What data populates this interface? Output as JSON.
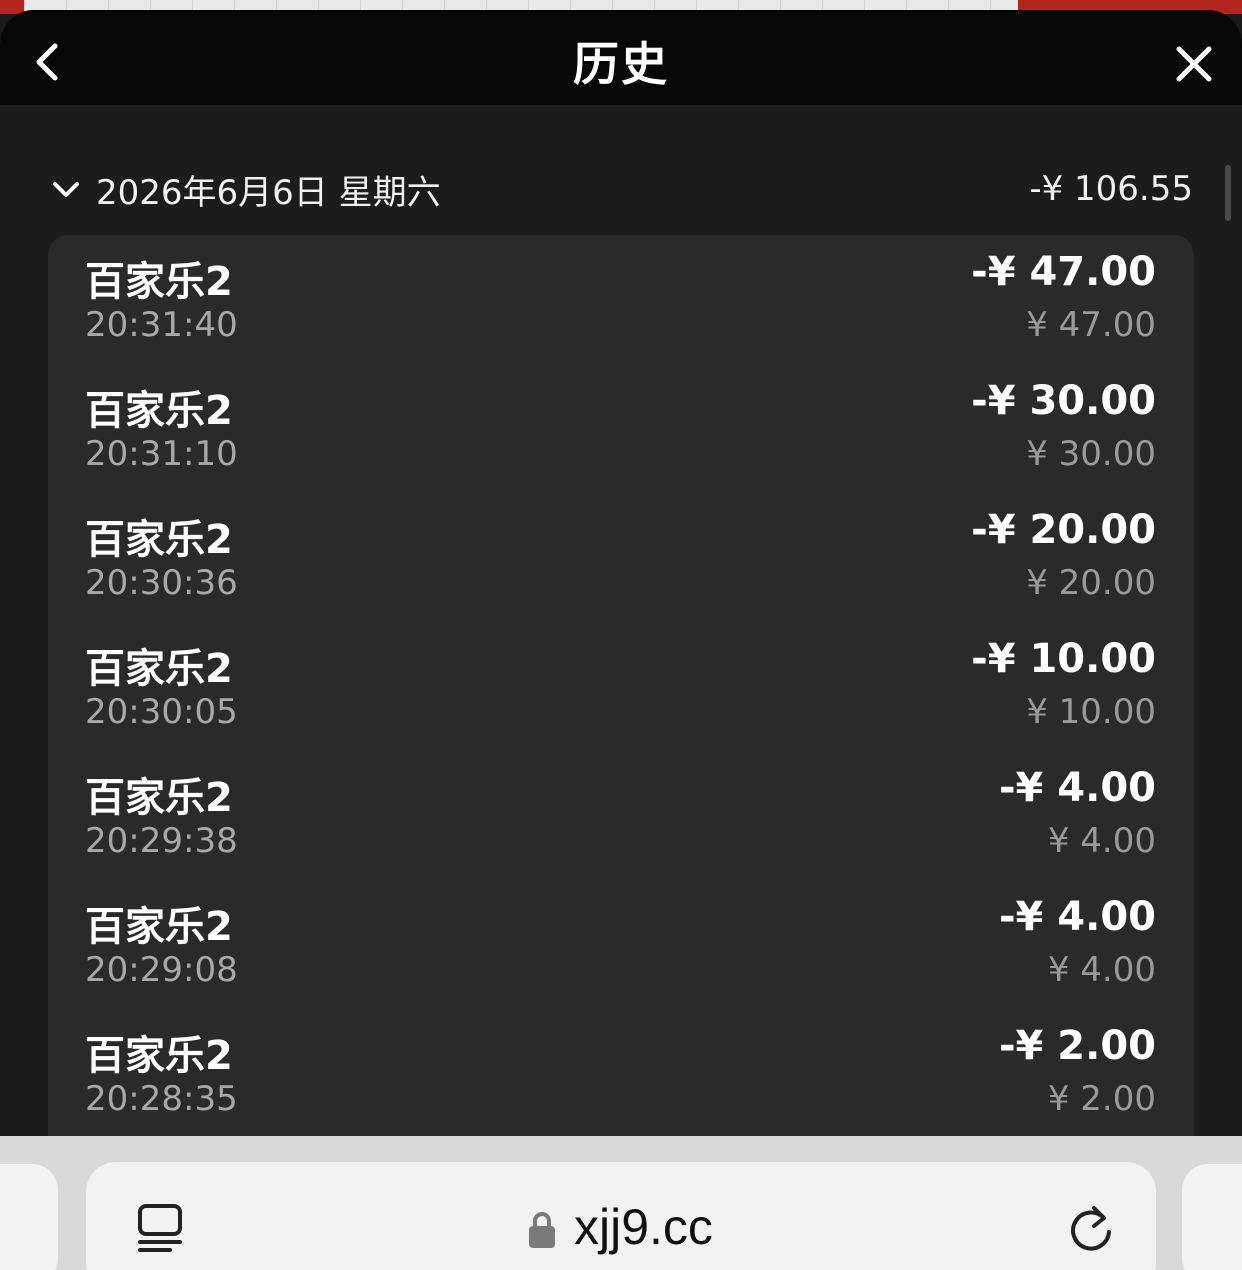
{
  "header": {
    "title": "历史",
    "back_icon": "chevron-left-icon",
    "close_icon": "close-icon"
  },
  "section": {
    "date": "2026年6月6日 星期六",
    "total": "-¥ 106.55",
    "expand_icon": "chevron-down-icon"
  },
  "transactions": [
    {
      "game": "百家乐2",
      "time": "20:31:40",
      "amount": "-¥ 47.00",
      "sub": "¥ 47.00"
    },
    {
      "game": "百家乐2",
      "time": "20:31:10",
      "amount": "-¥ 30.00",
      "sub": "¥ 30.00"
    },
    {
      "game": "百家乐2",
      "time": "20:30:36",
      "amount": "-¥ 20.00",
      "sub": "¥ 20.00"
    },
    {
      "game": "百家乐2",
      "time": "20:30:05",
      "amount": "-¥ 10.00",
      "sub": "¥ 10.00"
    },
    {
      "game": "百家乐2",
      "time": "20:29:38",
      "amount": "-¥ 4.00",
      "sub": "¥ 4.00"
    },
    {
      "game": "百家乐2",
      "time": "20:29:08",
      "amount": "-¥ 4.00",
      "sub": "¥ 4.00"
    },
    {
      "game": "百家乐2",
      "time": "20:28:35",
      "amount": "-¥ 2.00",
      "sub": "¥ 2.00"
    }
  ],
  "browser": {
    "url": "xjj9.cc",
    "tabs_icon": "tabs-icon",
    "lock_icon": "lock-icon",
    "reload_icon": "reload-icon"
  },
  "colors": {
    "header_bg": "#070707",
    "card_bg": "#2a2a2a",
    "secondary_text": "#a8a8a8"
  }
}
